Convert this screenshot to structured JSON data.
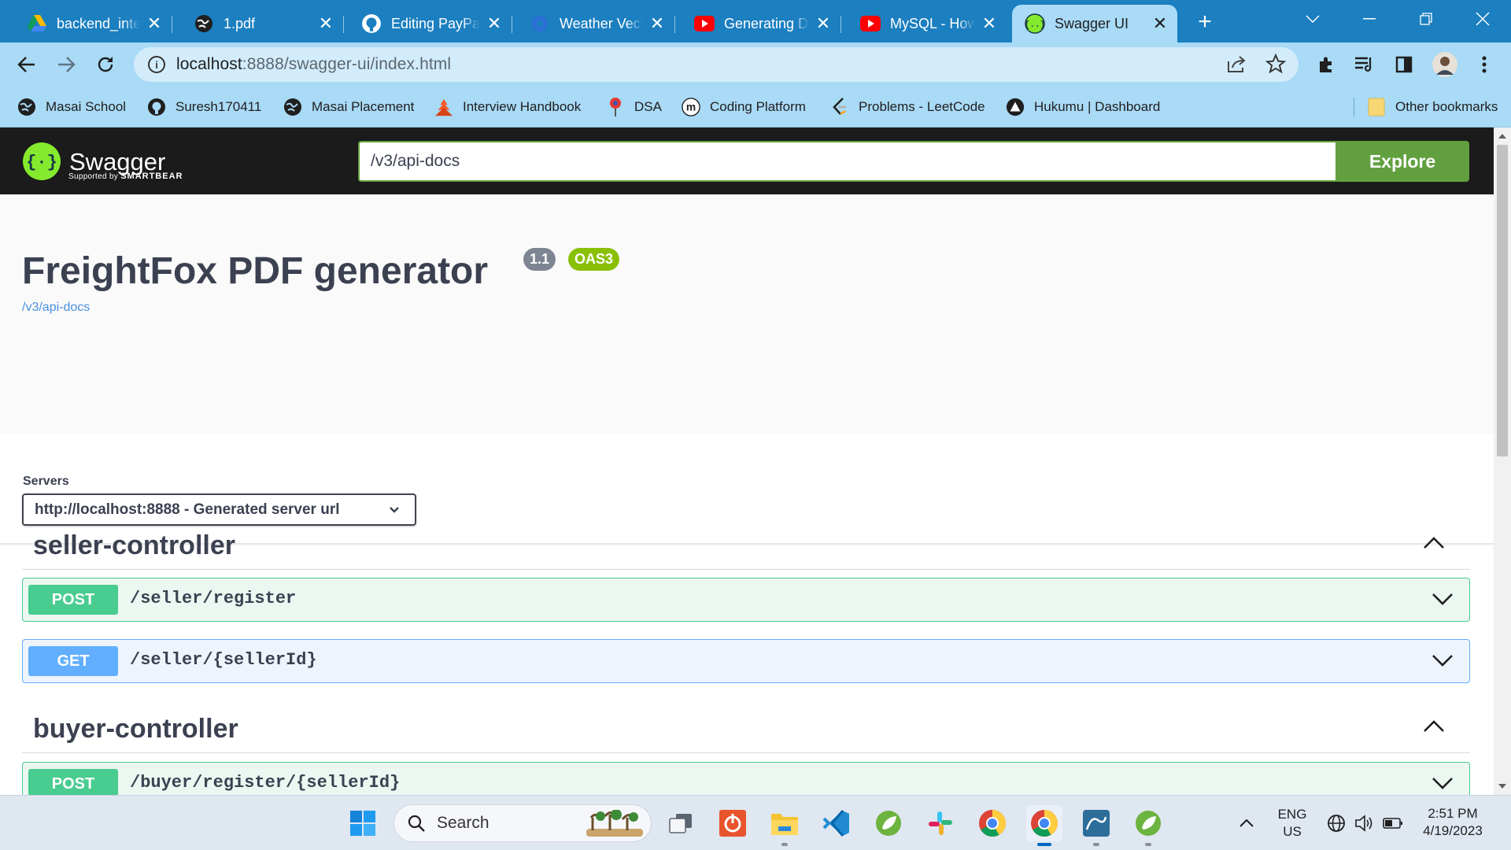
{
  "browser": {
    "tabs": [
      {
        "title": "backend_intern",
        "icon": "google-drive-icon"
      },
      {
        "title": "1.pdf",
        "icon": "globe-icon"
      },
      {
        "title": "Editing PayPal_",
        "icon": "github-icon"
      },
      {
        "title": "Weather Vecto",
        "icon": "weather-icon"
      },
      {
        "title": "Generating DE",
        "icon": "youtube-icon"
      },
      {
        "title": "MySQL - How",
        "icon": "youtube-icon"
      },
      {
        "title": "Swagger UI",
        "icon": "swagger-icon"
      }
    ],
    "address": {
      "host": "localhost",
      "rest": ":8888/swagger-ui/index.html"
    },
    "bookmarks": [
      {
        "label": "Masai School",
        "icon": "globe-icon"
      },
      {
        "label": "Suresh170411",
        "icon": "github-icon"
      },
      {
        "label": "Masai Placement",
        "icon": "globe-icon"
      },
      {
        "label": "Interview Handbook",
        "icon": "pagoda-icon"
      },
      {
        "label": "DSA",
        "icon": "pin-icon"
      },
      {
        "label": "Coding Platform",
        "icon": "m-icon"
      },
      {
        "label": "Problems - LeetCode",
        "icon": "leetcode-icon"
      },
      {
        "label": "Hukumu | Dashboard",
        "icon": "triangle-icon"
      }
    ],
    "other_bookmarks": "Other bookmarks"
  },
  "swagger": {
    "logo_word": "Swagger",
    "logo_supported": "Supported by",
    "logo_smartbear": "SMARTBEAR",
    "spec_url": "/v3/api-docs",
    "explore_label": "Explore",
    "title": "FreightFox PDF generator",
    "version": "1.1",
    "oas": "OAS3",
    "spec_link": "/v3/api-docs",
    "servers_label": "Servers",
    "server_selected": "http://localhost:8888 - Generated server url",
    "tags": [
      {
        "name": "seller-controller",
        "operations": [
          {
            "method": "POST",
            "path": "/seller/register"
          },
          {
            "method": "GET",
            "path": "/seller/{sellerId}"
          }
        ]
      },
      {
        "name": "buyer-controller",
        "operations": [
          {
            "method": "POST",
            "path": "/buyer/register/{sellerId}"
          }
        ]
      }
    ]
  },
  "taskbar": {
    "search_label": "Search",
    "lang_line1": "ENG",
    "lang_line2": "US",
    "time": "2:51 PM",
    "date": "4/19/2023"
  },
  "colors": {
    "chrome_tabstrip": "#1b7fc0",
    "chrome_toolbar": "#a9daf6",
    "swagger_green": "#62a03f",
    "post_green": "#49cc90",
    "get_blue": "#61affe",
    "oas_badge": "#89bf04"
  }
}
